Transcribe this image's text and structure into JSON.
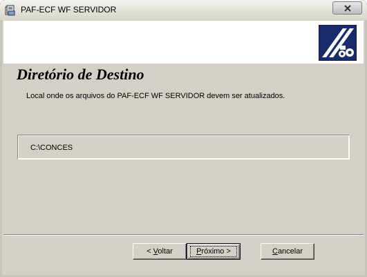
{
  "window": {
    "title": "PAF-ECF WF SERVIDOR",
    "close_icon": "close-icon",
    "app_icon": "installer-icon"
  },
  "header": {
    "logo_icon": "brand-logo"
  },
  "page": {
    "title": "Diretório de Destino",
    "description": "Local onde os arquivos do PAF-ECF WF SERVIDOR devem ser atualizados."
  },
  "destination": {
    "path": "C:\\CONCES"
  },
  "buttons": {
    "back": {
      "prefix": "< ",
      "accel": "V",
      "rest": "oltar"
    },
    "next": {
      "accel": "P",
      "rest": "róximo >"
    },
    "cancel": {
      "accel": "C",
      "rest": "ancelar"
    }
  },
  "colors": {
    "title_bar": "#e5e4dd",
    "dialog_face": "#d4d0c8",
    "logo_bg": "#1a2b6b"
  }
}
